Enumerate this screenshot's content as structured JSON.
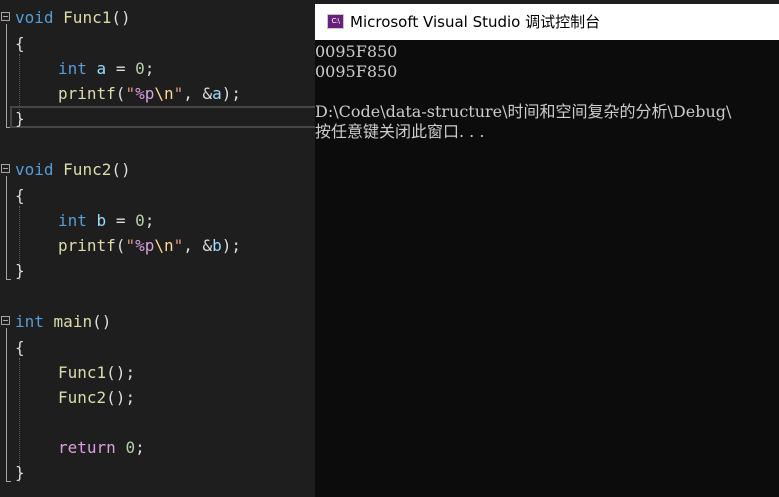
{
  "editor": {
    "lines": {
      "l1": {
        "kw": "void",
        "fn": "Func1",
        "punct": "()"
      },
      "l2": {
        "text": "{"
      },
      "l3": {
        "kw": "int",
        "var": "a",
        "mid": " = ",
        "num": "0",
        "end": ";"
      },
      "l4": {
        "fn": "printf",
        "open": "(",
        "str_open": "\"",
        "fmt": "%p",
        "esc": "\\n",
        "str_close": "\"",
        "sep": ", ",
        "amp": "&",
        "var": "a",
        "end": ");"
      },
      "l5": {
        "text": "}"
      },
      "l7": {
        "kw": "void",
        "fn": "Func2",
        "punct": "()"
      },
      "l8": {
        "text": "{"
      },
      "l9": {
        "kw": "int",
        "var": "b",
        "mid": " = ",
        "num": "0",
        "end": ";"
      },
      "l10": {
        "fn": "printf",
        "open": "(",
        "str_open": "\"",
        "fmt": "%p",
        "esc": "\\n",
        "str_close": "\"",
        "sep": ", ",
        "amp": "&",
        "var": "b",
        "end": ");"
      },
      "l11": {
        "text": "}"
      },
      "l13": {
        "kw": "int",
        "fn": "main",
        "punct": "()"
      },
      "l14": {
        "text": "{"
      },
      "l15": {
        "fn": "Func1",
        "end": "();"
      },
      "l16": {
        "fn": "Func2",
        "end": "();"
      },
      "l18": {
        "kw": "return",
        "sp": " ",
        "num": "0",
        "end": ";"
      },
      "l19": {
        "text": "}"
      }
    }
  },
  "console": {
    "title": "Microsoft Visual Studio 调试控制台",
    "icon_label": "C:\\",
    "output": [
      "0095F850",
      "0095F850",
      "",
      "D:\\Code\\data-structure\\时间和空间复杂的分析\\Debug\\",
      "按任意键关闭此窗口. . ."
    ]
  },
  "colors": {
    "editor_bg": "#1e1e1e",
    "keyword": "#569cd6",
    "function": "#dcdcaa",
    "variable": "#9cdcfe",
    "number": "#b5cea8",
    "string": "#d69d85",
    "escape": "#ffd68f",
    "control_keyword": "#d8a0df",
    "console_bg": "#0c0c0c",
    "console_text": "#cccccc"
  }
}
